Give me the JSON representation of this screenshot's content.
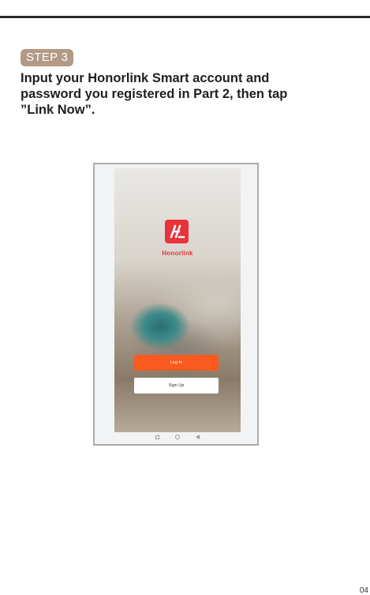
{
  "step": {
    "label": "STEP 3"
  },
  "instruction": "Input your Honorlink Smart  account and\npassword you registered in Part 2, then tap\n”Link Now”.",
  "app": {
    "brand_name": "Honorlink",
    "login_label": "Log In",
    "signup_label": "Sign Up"
  },
  "page_number": "04",
  "colors": {
    "badge": "#b39a86",
    "brand_red": "#e8333a",
    "login_orange": "#fb5a1e"
  }
}
